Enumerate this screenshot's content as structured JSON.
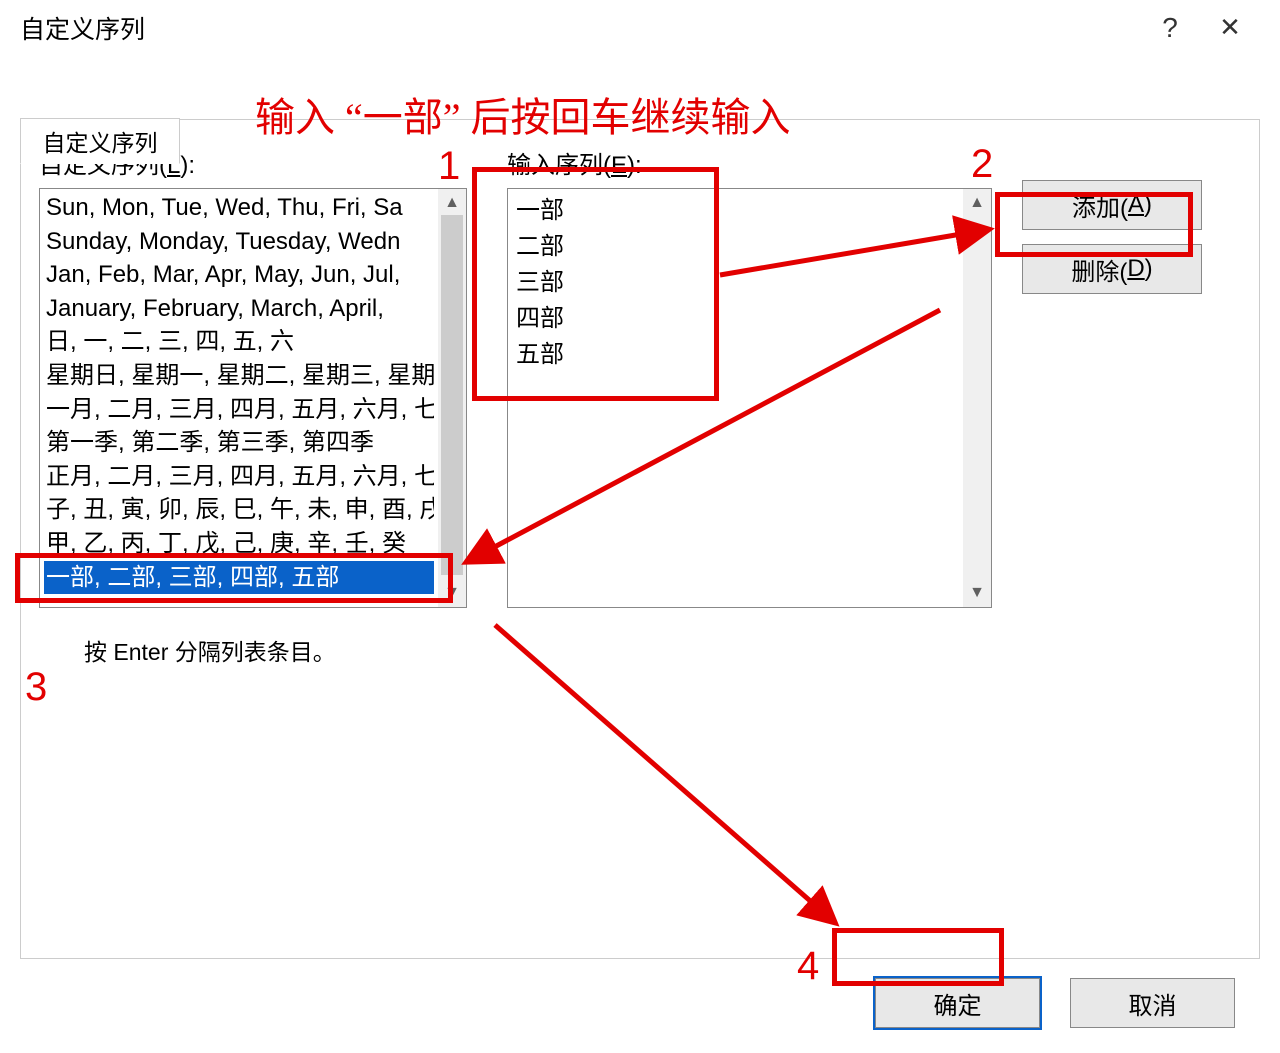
{
  "titlebar": {
    "title": "自定义序列",
    "help": "?",
    "close": "✕"
  },
  "tab": {
    "label": "自定义序列"
  },
  "labels": {
    "customList": "自定义序列(",
    "customListU": "L",
    "customListEnd": "):",
    "inputSeq": "输入序列(",
    "inputSeqU": "E",
    "inputSeqEnd": "):",
    "hint": "按 Enter 分隔列表条目。"
  },
  "customLists": [
    "Sun, Mon, Tue, Wed, Thu, Fri, Sa",
    "Sunday, Monday, Tuesday, Wedn",
    "Jan, Feb, Mar, Apr, May, Jun, Jul,",
    "January, February, March, April,",
    "日, 一, 二, 三, 四, 五, 六",
    "星期日, 星期一, 星期二, 星期三, 星期",
    "一月, 二月, 三月, 四月, 五月, 六月, 七",
    "第一季, 第二季, 第三季, 第四季",
    "正月, 二月, 三月, 四月, 五月, 六月, 七",
    "子, 丑, 寅, 卯, 辰, 巳, 午, 未, 申, 酉, 戌",
    "甲, 乙, 丙, 丁, 戊, 己, 庚, 辛, 壬, 癸"
  ],
  "selectedList": "一部, 二部, 三部, 四部, 五部",
  "inputLines": [
    "一部",
    "二部",
    "三部",
    "四部",
    "五部"
  ],
  "buttons": {
    "add": "添加(",
    "addU": "A",
    "addEnd": ")",
    "delete": "删除(",
    "deleteU": "D",
    "deleteEnd": ")",
    "ok": "确定",
    "cancel": "取消"
  },
  "annotations": {
    "instruction": "输入 “一部” 后按回车继续输入",
    "n1": "1",
    "n2": "2",
    "n3": "3",
    "n4": "4"
  }
}
